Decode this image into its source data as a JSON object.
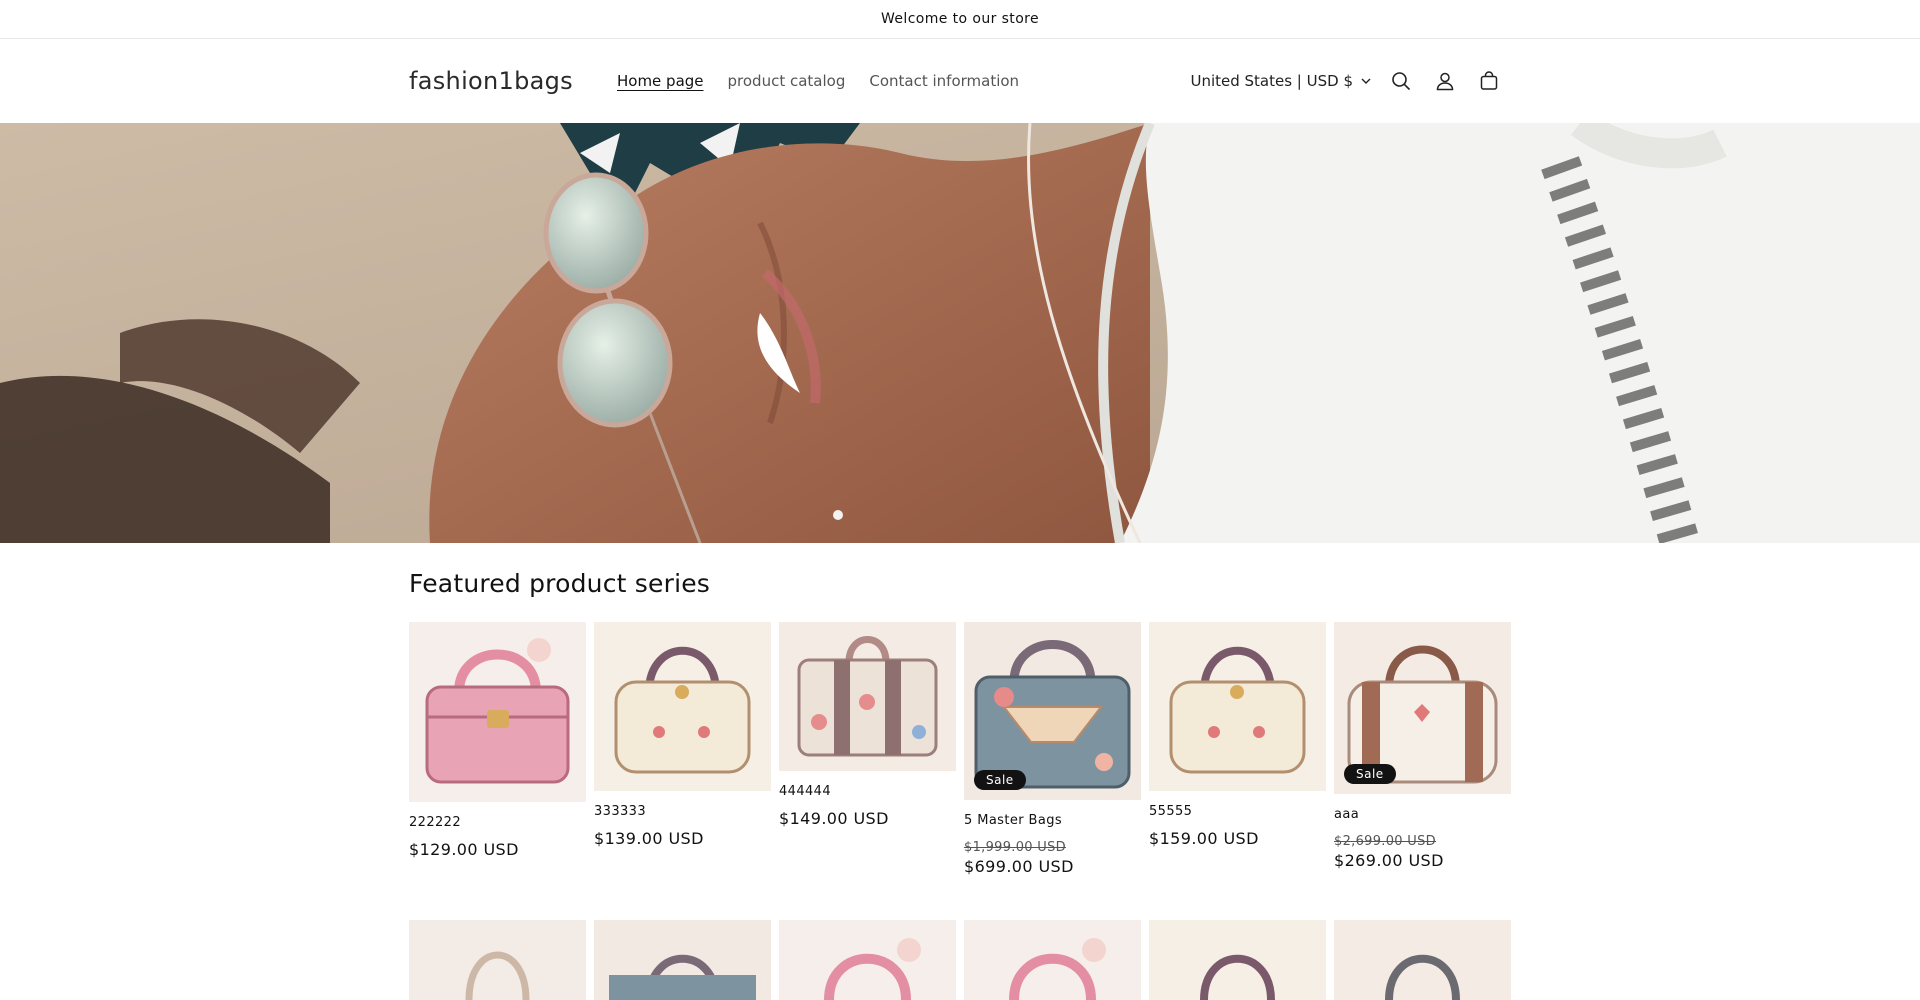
{
  "announcement": {
    "text": "Welcome to our store"
  },
  "header": {
    "logo": "fashion1bags",
    "nav": [
      {
        "label": "Home page",
        "active": true
      },
      {
        "label": "product catalog",
        "active": false
      },
      {
        "label": "Contact information",
        "active": false
      }
    ],
    "locale": "United States | USD $",
    "icons": [
      "search-icon",
      "account-icon",
      "cart-icon"
    ]
  },
  "featured": {
    "title": "Featured product series",
    "products": [
      {
        "name": "222222",
        "price": "$129.00 USD",
        "sale": false,
        "compare": "",
        "palette": "pink"
      },
      {
        "name": "333333",
        "price": "$139.00 USD",
        "sale": false,
        "compare": "",
        "palette": "cream"
      },
      {
        "name": "444444",
        "price": "$149.00 USD",
        "sale": false,
        "compare": "",
        "palette": "floral"
      },
      {
        "name": "5 Master Bags",
        "price": "$699.00 USD",
        "sale": true,
        "compare": "$1,999.00 USD",
        "badge": "Sale",
        "palette": "blue"
      },
      {
        "name": "55555",
        "price": "$159.00 USD",
        "sale": false,
        "compare": "",
        "palette": "cream"
      },
      {
        "name": "aaa",
        "price": "$269.00 USD",
        "sale": true,
        "compare": "$2,699.00 USD",
        "badge": "Sale",
        "palette": "white"
      }
    ]
  },
  "colors": {
    "text": "#121212",
    "badge_bg": "#121212",
    "bag_pink": "#e8a4b4",
    "bag_cream": "#f3ead8",
    "bag_blue": "#7d93a0",
    "strap_brown": "#8a5a48"
  }
}
